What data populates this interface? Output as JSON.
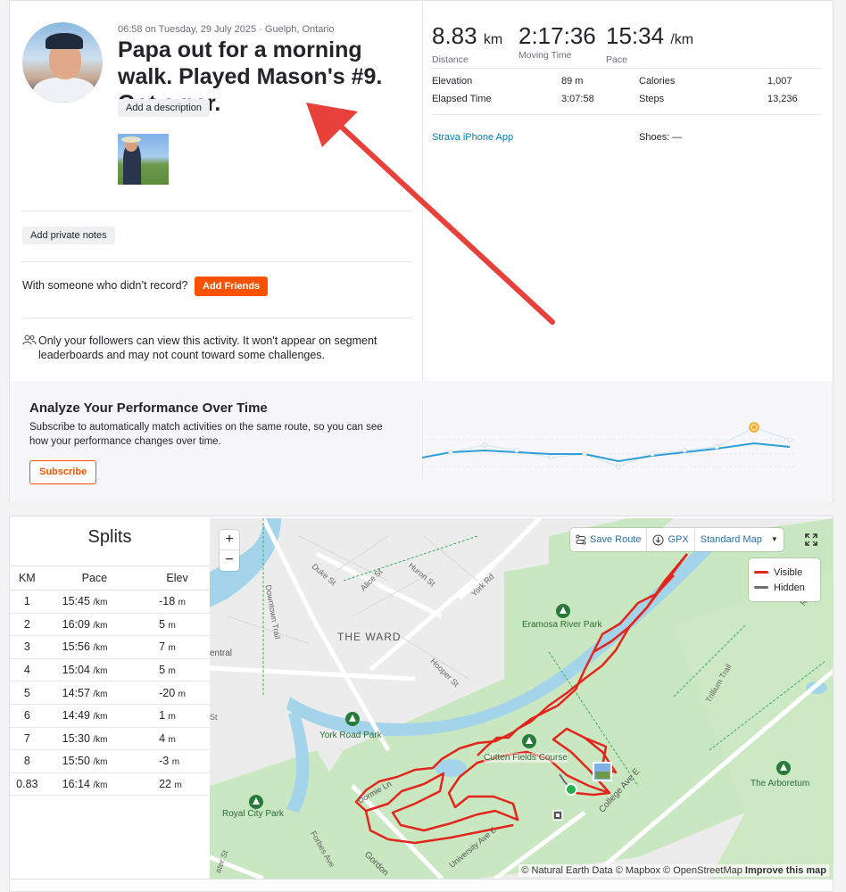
{
  "activity": {
    "meta": "06:58 on Tuesday, 29 July 2025 · Guelph, Ontario",
    "title": "Papa out for a morning walk. Played Mason's #9. Got a par.",
    "add_description": "Add a description",
    "add_private_notes": "Add private notes",
    "friends_prompt": "With someone who didn’t record?",
    "add_friends": "Add Friends",
    "privacy_note": "Only your followers can view this activity. It won't appear on segment leaderboards and may not count toward some challenges."
  },
  "stats": {
    "distance": {
      "value": "8.83",
      "unit": "km",
      "label": "Distance"
    },
    "moving_time": {
      "value": "2:17:36",
      "label": "Moving Time"
    },
    "pace": {
      "value": "15:34",
      "unit": "/km",
      "label": "Pace"
    },
    "elevation": {
      "label": "Elevation",
      "value": "89 m"
    },
    "elapsed": {
      "label": "Elapsed Time",
      "value": "3:07:58"
    },
    "calories": {
      "label": "Calories",
      "value": "1,007"
    },
    "steps": {
      "label": "Steps",
      "value": "13,236"
    },
    "device": "Strava iPhone App",
    "shoes": "Shoes: —"
  },
  "analyze": {
    "title": "Analyze Your Performance Over Time",
    "text": "Subscribe to automatically match activities on the same route, so you can see how your performance changes over time.",
    "subscribe": "Subscribe"
  },
  "splits": {
    "title": "Splits",
    "headers": [
      "KM",
      "Pace",
      "Elev"
    ],
    "pace_unit": "/km",
    "elev_unit": "m",
    "rows": [
      {
        "km": "1",
        "pace": "15:45",
        "elev": "-18"
      },
      {
        "km": "2",
        "pace": "16:09",
        "elev": "5"
      },
      {
        "km": "3",
        "pace": "15:56",
        "elev": "7"
      },
      {
        "km": "4",
        "pace": "15:04",
        "elev": "5"
      },
      {
        "km": "5",
        "pace": "14:57",
        "elev": "-20"
      },
      {
        "km": "6",
        "pace": "14:49",
        "elev": "1"
      },
      {
        "km": "7",
        "pace": "15:30",
        "elev": "4"
      },
      {
        "km": "8",
        "pace": "15:50",
        "elev": "-3"
      },
      {
        "km": "0.83",
        "pace": "16:14",
        "elev": "22"
      }
    ]
  },
  "map": {
    "zoom_in": "+",
    "zoom_out": "−",
    "save_route": "Save Route",
    "gpx": "GPX",
    "map_style": "Standard Map",
    "legend_visible": "Visible",
    "legend_hidden": "Hidden",
    "labels": {
      "the_ward": "THE WARD",
      "eramosa": "Eramosa River Park",
      "york_road_park": "York Road Park",
      "cutten": "Cutten Fields Course",
      "royal_city": "Royal City Park",
      "arboretum": "The Arboretum",
      "duke": "Duke St",
      "alice": "Alice St",
      "huron": "Huron St",
      "york_rd": "York Rd",
      "hooper": "Hooper St",
      "downtown_trail": "Downtown Trail",
      "college": "College Ave E",
      "trillium": "Trillium Trail",
      "dormie": "Dormie Ln",
      "forbes": "Forbes Ave",
      "gordon": "Gordon",
      "university": "University Ave E",
      "central": "entral",
      "water_st": "ater St",
      "st": "St",
      "rd_s": "Rd S"
    },
    "attribution": "© Natural Earth Data © Mapbox © OpenStreetMap",
    "improve": "Improve this map",
    "colors": {
      "visible": "#e3261c",
      "hidden": "#6d6d78",
      "park": "#c9e7c0",
      "water": "#a4d4ea"
    }
  }
}
